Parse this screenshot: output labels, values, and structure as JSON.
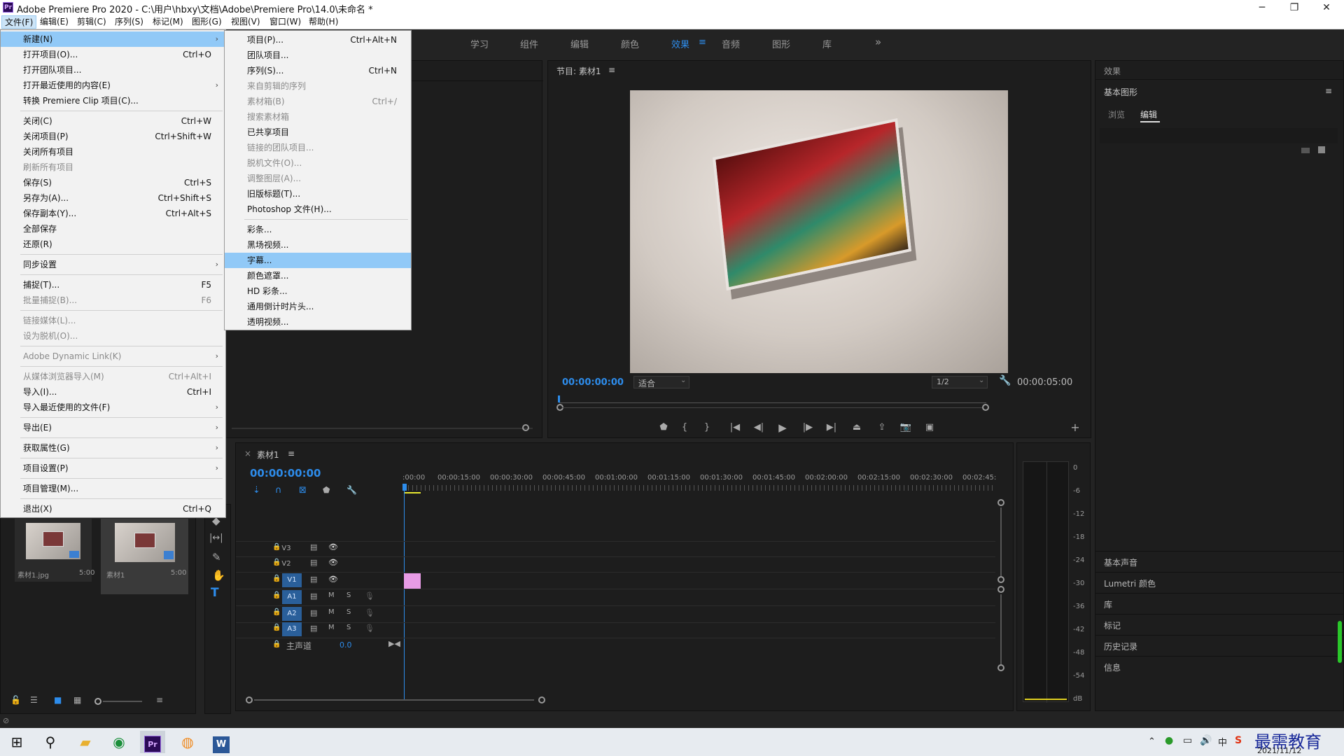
{
  "window": {
    "app_badge": "Pr",
    "title": "Adobe Premiere Pro 2020 - C:\\用户\\hbxy\\文档\\Adobe\\Premiere Pro\\14.0\\未命名 *",
    "minimize": "─",
    "maximize": "❐",
    "close": "✕"
  },
  "menubar": [
    "文件(F)",
    "编辑(E)",
    "剪辑(C)",
    "序列(S)",
    "标记(M)",
    "图形(G)",
    "视图(V)",
    "窗口(W)",
    "帮助(H)"
  ],
  "workspaces": [
    "学习",
    "组件",
    "编辑",
    "颜色",
    "效果",
    "音频",
    "图形",
    "库"
  ],
  "workspace_active": "效果",
  "workspace_menu_icon": "≡",
  "workspace_more": "»",
  "file_menu": [
    {
      "label": "新建(N)",
      "shortcut": "",
      "submenu": true,
      "disabled": false,
      "highlight": true
    },
    {
      "label": "打开项目(O)...",
      "shortcut": "Ctrl+O"
    },
    {
      "label": "打开团队项目..."
    },
    {
      "label": "打开最近使用的内容(E)",
      "submenu": true
    },
    {
      "label": "转换 Premiere Clip 项目(C)..."
    },
    {
      "sep": true
    },
    {
      "label": "关闭(C)",
      "shortcut": "Ctrl+W"
    },
    {
      "label": "关闭项目(P)",
      "shortcut": "Ctrl+Shift+W"
    },
    {
      "label": "关闭所有项目"
    },
    {
      "label": "刷新所有项目",
      "disabled": true
    },
    {
      "label": "保存(S)",
      "shortcut": "Ctrl+S"
    },
    {
      "label": "另存为(A)...",
      "shortcut": "Ctrl+Shift+S"
    },
    {
      "label": "保存副本(Y)...",
      "shortcut": "Ctrl+Alt+S"
    },
    {
      "label": "全部保存"
    },
    {
      "label": "还原(R)"
    },
    {
      "sep": true
    },
    {
      "label": "同步设置",
      "submenu": true
    },
    {
      "sep": true
    },
    {
      "label": "捕捉(T)...",
      "shortcut": "F5"
    },
    {
      "label": "批量捕捉(B)...",
      "shortcut": "F6",
      "disabled": true
    },
    {
      "sep": true
    },
    {
      "label": "链接媒体(L)...",
      "disabled": true
    },
    {
      "label": "设为脱机(O)...",
      "disabled": true
    },
    {
      "sep": true
    },
    {
      "label": "Adobe Dynamic Link(K)",
      "submenu": true,
      "disabled": true
    },
    {
      "sep": true
    },
    {
      "label": "从媒体浏览器导入(M)",
      "shortcut": "Ctrl+Alt+I",
      "disabled": true
    },
    {
      "label": "导入(I)...",
      "shortcut": "Ctrl+I"
    },
    {
      "label": "导入最近使用的文件(F)",
      "submenu": true
    },
    {
      "sep": true
    },
    {
      "label": "导出(E)",
      "submenu": true
    },
    {
      "sep": true
    },
    {
      "label": "获取属性(G)",
      "submenu": true
    },
    {
      "sep": true
    },
    {
      "label": "项目设置(P)",
      "submenu": true
    },
    {
      "sep": true
    },
    {
      "label": "项目管理(M)..."
    },
    {
      "sep": true
    },
    {
      "label": "退出(X)",
      "shortcut": "Ctrl+Q"
    }
  ],
  "new_submenu": [
    {
      "label": "项目(P)...",
      "shortcut": "Ctrl+Alt+N"
    },
    {
      "label": "团队项目..."
    },
    {
      "label": "序列(S)...",
      "shortcut": "Ctrl+N"
    },
    {
      "label": "来自剪辑的序列",
      "disabled": true
    },
    {
      "label": "素材箱(B)",
      "shortcut": "Ctrl+/",
      "disabled": true
    },
    {
      "label": "搜索素材箱",
      "disabled": true
    },
    {
      "label": "已共享项目"
    },
    {
      "label": "链接的团队项目...",
      "disabled": true
    },
    {
      "label": "脱机文件(O)...",
      "disabled": true
    },
    {
      "label": "调整图层(A)...",
      "disabled": true
    },
    {
      "label": "旧版标题(T)..."
    },
    {
      "label": "Photoshop 文件(H)..."
    },
    {
      "sep": true
    },
    {
      "label": "彩条..."
    },
    {
      "label": "黑场视频..."
    },
    {
      "label": "字幕...",
      "highlight": true
    },
    {
      "label": "颜色遮罩..."
    },
    {
      "label": "HD 彩条..."
    },
    {
      "label": "通用倒计时片头..."
    },
    {
      "label": "透明视频..."
    }
  ],
  "program_monitor": {
    "title": "节目: 素材1",
    "menu_icon": "≡",
    "timecode_current": "00:00:00:00",
    "fit_label": "适合",
    "resolution": "1/2",
    "timecode_duration": "00:00:05:00"
  },
  "effects_panel": {
    "title": "效果",
    "essential_graphics": "基本图形",
    "tabs": [
      "浏览",
      "编辑"
    ],
    "active_tab": "编辑",
    "menu_icon": "≡",
    "collapsed": [
      "基本声音",
      "Lumetri 颜色",
      "库",
      "标记",
      "历史记录",
      "信息"
    ]
  },
  "project_items": [
    {
      "name": "素材1.jpg",
      "duration": "5:00"
    },
    {
      "name": "素材1",
      "duration": "5:00"
    }
  ],
  "timeline": {
    "close": "×",
    "tab": "素材1",
    "menu_icon": "≡",
    "timecode": "00:00:00:00",
    "ruler": [
      ":00:00",
      "00:00:15:00",
      "00:00:30:00",
      "00:00:45:00",
      "00:01:00:00",
      "00:01:15:00",
      "00:01:30:00",
      "00:01:45:00",
      "00:02:00:00",
      "00:02:15:00",
      "00:02:30:00",
      "00:02:45:"
    ],
    "video_tracks": [
      "V3",
      "V2",
      "V1"
    ],
    "audio_tracks": [
      "A1",
      "A2",
      "A3"
    ],
    "mute_label": "M",
    "solo_label": "S",
    "master_label": "主声道",
    "master_value": "0.0"
  },
  "audio_meter_ticks": [
    "0",
    "-6",
    "-12",
    "-18",
    "-24",
    "-30",
    "-36",
    "-42",
    "-48",
    "-54",
    "dB"
  ],
  "taskbar": {
    "ime": "中",
    "clock_date": "2021/11/12",
    "watermark": "最需教育"
  },
  "colors": {
    "accent": "#2d8ceb",
    "menu_highlight": "#91c9f7",
    "clip_pink": "#e89be6"
  }
}
